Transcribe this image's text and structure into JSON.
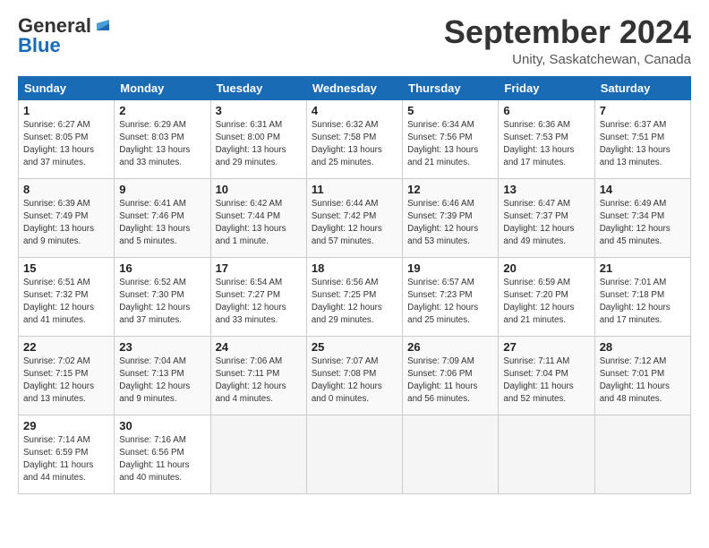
{
  "logo": {
    "line1": "General",
    "line2": "Blue"
  },
  "title": "September 2024",
  "subtitle": "Unity, Saskatchewan, Canada",
  "weekdays": [
    "Sunday",
    "Monday",
    "Tuesday",
    "Wednesday",
    "Thursday",
    "Friday",
    "Saturday"
  ],
  "weeks": [
    [
      {
        "num": "1",
        "sunrise": "Sunrise: 6:27 AM",
        "sunset": "Sunset: 8:05 PM",
        "daylight": "Daylight: 13 hours and 37 minutes."
      },
      {
        "num": "2",
        "sunrise": "Sunrise: 6:29 AM",
        "sunset": "Sunset: 8:03 PM",
        "daylight": "Daylight: 13 hours and 33 minutes."
      },
      {
        "num": "3",
        "sunrise": "Sunrise: 6:31 AM",
        "sunset": "Sunset: 8:00 PM",
        "daylight": "Daylight: 13 hours and 29 minutes."
      },
      {
        "num": "4",
        "sunrise": "Sunrise: 6:32 AM",
        "sunset": "Sunset: 7:58 PM",
        "daylight": "Daylight: 13 hours and 25 minutes."
      },
      {
        "num": "5",
        "sunrise": "Sunrise: 6:34 AM",
        "sunset": "Sunset: 7:56 PM",
        "daylight": "Daylight: 13 hours and 21 minutes."
      },
      {
        "num": "6",
        "sunrise": "Sunrise: 6:36 AM",
        "sunset": "Sunset: 7:53 PM",
        "daylight": "Daylight: 13 hours and 17 minutes."
      },
      {
        "num": "7",
        "sunrise": "Sunrise: 6:37 AM",
        "sunset": "Sunset: 7:51 PM",
        "daylight": "Daylight: 13 hours and 13 minutes."
      }
    ],
    [
      {
        "num": "8",
        "sunrise": "Sunrise: 6:39 AM",
        "sunset": "Sunset: 7:49 PM",
        "daylight": "Daylight: 13 hours and 9 minutes."
      },
      {
        "num": "9",
        "sunrise": "Sunrise: 6:41 AM",
        "sunset": "Sunset: 7:46 PM",
        "daylight": "Daylight: 13 hours and 5 minutes."
      },
      {
        "num": "10",
        "sunrise": "Sunrise: 6:42 AM",
        "sunset": "Sunset: 7:44 PM",
        "daylight": "Daylight: 13 hours and 1 minute."
      },
      {
        "num": "11",
        "sunrise": "Sunrise: 6:44 AM",
        "sunset": "Sunset: 7:42 PM",
        "daylight": "Daylight: 12 hours and 57 minutes."
      },
      {
        "num": "12",
        "sunrise": "Sunrise: 6:46 AM",
        "sunset": "Sunset: 7:39 PM",
        "daylight": "Daylight: 12 hours and 53 minutes."
      },
      {
        "num": "13",
        "sunrise": "Sunrise: 6:47 AM",
        "sunset": "Sunset: 7:37 PM",
        "daylight": "Daylight: 12 hours and 49 minutes."
      },
      {
        "num": "14",
        "sunrise": "Sunrise: 6:49 AM",
        "sunset": "Sunset: 7:34 PM",
        "daylight": "Daylight: 12 hours and 45 minutes."
      }
    ],
    [
      {
        "num": "15",
        "sunrise": "Sunrise: 6:51 AM",
        "sunset": "Sunset: 7:32 PM",
        "daylight": "Daylight: 12 hours and 41 minutes."
      },
      {
        "num": "16",
        "sunrise": "Sunrise: 6:52 AM",
        "sunset": "Sunset: 7:30 PM",
        "daylight": "Daylight: 12 hours and 37 minutes."
      },
      {
        "num": "17",
        "sunrise": "Sunrise: 6:54 AM",
        "sunset": "Sunset: 7:27 PM",
        "daylight": "Daylight: 12 hours and 33 minutes."
      },
      {
        "num": "18",
        "sunrise": "Sunrise: 6:56 AM",
        "sunset": "Sunset: 7:25 PM",
        "daylight": "Daylight: 12 hours and 29 minutes."
      },
      {
        "num": "19",
        "sunrise": "Sunrise: 6:57 AM",
        "sunset": "Sunset: 7:23 PM",
        "daylight": "Daylight: 12 hours and 25 minutes."
      },
      {
        "num": "20",
        "sunrise": "Sunrise: 6:59 AM",
        "sunset": "Sunset: 7:20 PM",
        "daylight": "Daylight: 12 hours and 21 minutes."
      },
      {
        "num": "21",
        "sunrise": "Sunrise: 7:01 AM",
        "sunset": "Sunset: 7:18 PM",
        "daylight": "Daylight: 12 hours and 17 minutes."
      }
    ],
    [
      {
        "num": "22",
        "sunrise": "Sunrise: 7:02 AM",
        "sunset": "Sunset: 7:15 PM",
        "daylight": "Daylight: 12 hours and 13 minutes."
      },
      {
        "num": "23",
        "sunrise": "Sunrise: 7:04 AM",
        "sunset": "Sunset: 7:13 PM",
        "daylight": "Daylight: 12 hours and 9 minutes."
      },
      {
        "num": "24",
        "sunrise": "Sunrise: 7:06 AM",
        "sunset": "Sunset: 7:11 PM",
        "daylight": "Daylight: 12 hours and 4 minutes."
      },
      {
        "num": "25",
        "sunrise": "Sunrise: 7:07 AM",
        "sunset": "Sunset: 7:08 PM",
        "daylight": "Daylight: 12 hours and 0 minutes."
      },
      {
        "num": "26",
        "sunrise": "Sunrise: 7:09 AM",
        "sunset": "Sunset: 7:06 PM",
        "daylight": "Daylight: 11 hours and 56 minutes."
      },
      {
        "num": "27",
        "sunrise": "Sunrise: 7:11 AM",
        "sunset": "Sunset: 7:04 PM",
        "daylight": "Daylight: 11 hours and 52 minutes."
      },
      {
        "num": "28",
        "sunrise": "Sunrise: 7:12 AM",
        "sunset": "Sunset: 7:01 PM",
        "daylight": "Daylight: 11 hours and 48 minutes."
      }
    ],
    [
      {
        "num": "29",
        "sunrise": "Sunrise: 7:14 AM",
        "sunset": "Sunset: 6:59 PM",
        "daylight": "Daylight: 11 hours and 44 minutes."
      },
      {
        "num": "30",
        "sunrise": "Sunrise: 7:16 AM",
        "sunset": "Sunset: 6:56 PM",
        "daylight": "Daylight: 11 hours and 40 minutes."
      },
      null,
      null,
      null,
      null,
      null
    ]
  ]
}
